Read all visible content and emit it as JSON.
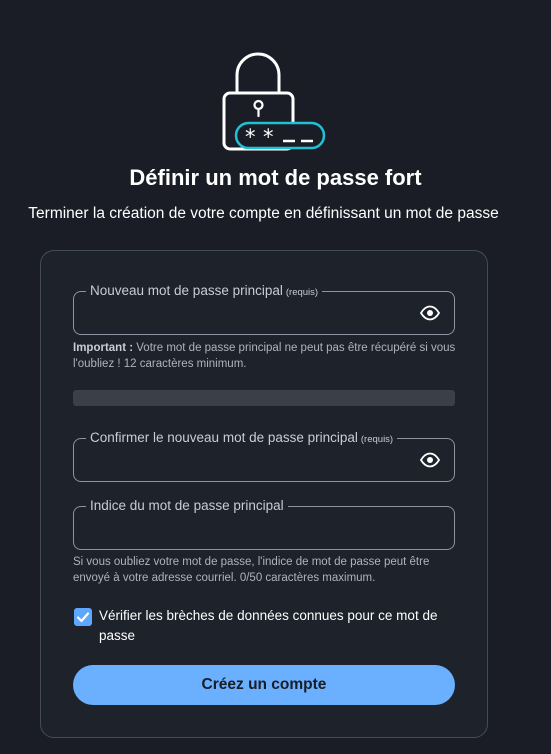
{
  "header": {
    "title": "Définir un mot de passe fort",
    "subtitle": "Terminer la création de votre compte en définissant un mot de passe"
  },
  "form": {
    "new_password": {
      "label": "Nouveau mot de passe principal",
      "required": "(requis)",
      "value": ""
    },
    "important_hint": {
      "prefix": "Important :",
      "text": "Votre mot de passe principal ne peut pas être récupéré si vous l'oubliez ! 12 caractères minimum."
    },
    "confirm_password": {
      "label": "Confirmer le nouveau mot de passe principal",
      "required": "(requis)",
      "value": ""
    },
    "password_hint": {
      "label": "Indice du mot de passe principal",
      "value": ""
    },
    "hint_help": "Si vous oubliez votre mot de passe, l'indice de mot de passe peut être envoyé à votre adresse courriel. 0/50 caractères maximum.",
    "breach_check": {
      "label": "Vérifier les brèches de données connues pour ce mot de passe",
      "checked": true
    },
    "submit_label": "Créez un compte"
  },
  "icons": {
    "hero": "lock-password-icon",
    "toggle_visibility": "eye-icon",
    "checkbox": "check-icon"
  },
  "colors": {
    "background": "#1a1d25",
    "card": "#1e222b",
    "accent": "#6bb0ff",
    "hero_accent": "#20c1d4"
  }
}
